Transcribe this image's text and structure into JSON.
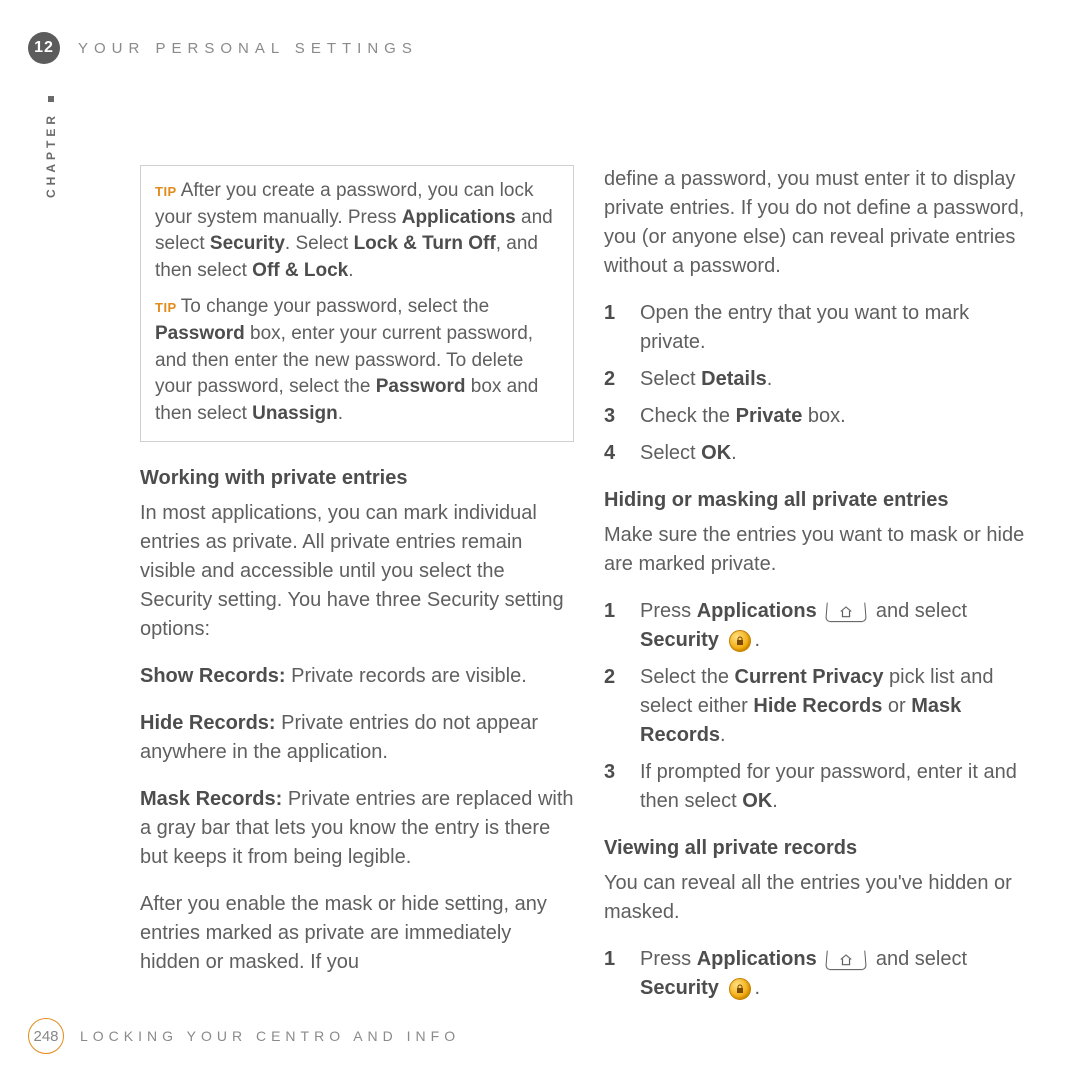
{
  "header": {
    "chapter_number": "12",
    "chapter_title": "YOUR PERSONAL SETTINGS",
    "vertical_label": "CHAPTER"
  },
  "left": {
    "tip": {
      "label": "TIP",
      "p1_a": "After you create a password, you can lock your system manually. Press ",
      "p1_b1": "Applications",
      "p1_c": " and select ",
      "p1_b2": "Security",
      "p1_d": ". Select ",
      "p1_b3": "Lock & Turn Off",
      "p1_e": ", and then select ",
      "p1_b4": "Off & Lock",
      "p1_f": ".",
      "p2_a": "To change your password, select the ",
      "p2_b1": "Password",
      "p2_c": " box, enter your current password, and then enter the new password. To delete your password, select the ",
      "p2_b2": "Password",
      "p2_d": " box and then select ",
      "p2_b3": "Unassign",
      "p2_e": "."
    },
    "h1": "Working with private entries",
    "p1": "In most applications, you can mark individual entries as private. All private entries remain visible and accessible until you select the Security setting. You have three Security setting options:",
    "show_lead": "Show Records:",
    "show_body": " Private records are visible.",
    "hide_lead": "Hide Records:",
    "hide_body": " Private entries do not appear anywhere in the application.",
    "mask_lead": "Mask Records:",
    "mask_body": " Private entries are replaced with a gray bar that lets you know the entry is there but keeps it from being legible.",
    "p_after": "After you enable the mask or hide setting, any entries marked as private are immediately hidden or masked. If you"
  },
  "right": {
    "p0": "define a password, you must enter it to display private entries. If you do not define a password, you (or anyone else) can reveal private entries without a password.",
    "steps1": {
      "s1": "Open the entry that you want to mark private.",
      "s2_a": "Select ",
      "s2_b": "Details",
      "s2_c": ".",
      "s3_a": "Check the ",
      "s3_b": "Private",
      "s3_c": " box.",
      "s4_a": "Select ",
      "s4_b": "OK",
      "s4_c": "."
    },
    "h2": "Hiding or masking all private entries",
    "p2": "Make sure the entries you want to mask or hide are marked private.",
    "steps2": {
      "s1_a": "Press ",
      "s1_b": "Applications",
      "s1_c": " and select ",
      "s1_d": "Security",
      "s1_e": ".",
      "s2_a": "Select the ",
      "s2_b": "Current Privacy",
      "s2_c": " pick list and select either ",
      "s2_d": "Hide Records",
      "s2_e": " or ",
      "s2_f": "Mask Records",
      "s2_g": ".",
      "s3_a": "If prompted for your password, enter it and then select ",
      "s3_b": "OK",
      "s3_c": "."
    },
    "h3": "Viewing all private records",
    "p3": "You can reveal all the entries you've hidden or masked.",
    "steps3": {
      "s1_a": "Press ",
      "s1_b": "Applications",
      "s1_c": " and select ",
      "s1_d": "Security",
      "s1_e": "."
    }
  },
  "footer": {
    "page_number": "248",
    "section_title": "LOCKING YOUR CENTRO AND INFO"
  }
}
